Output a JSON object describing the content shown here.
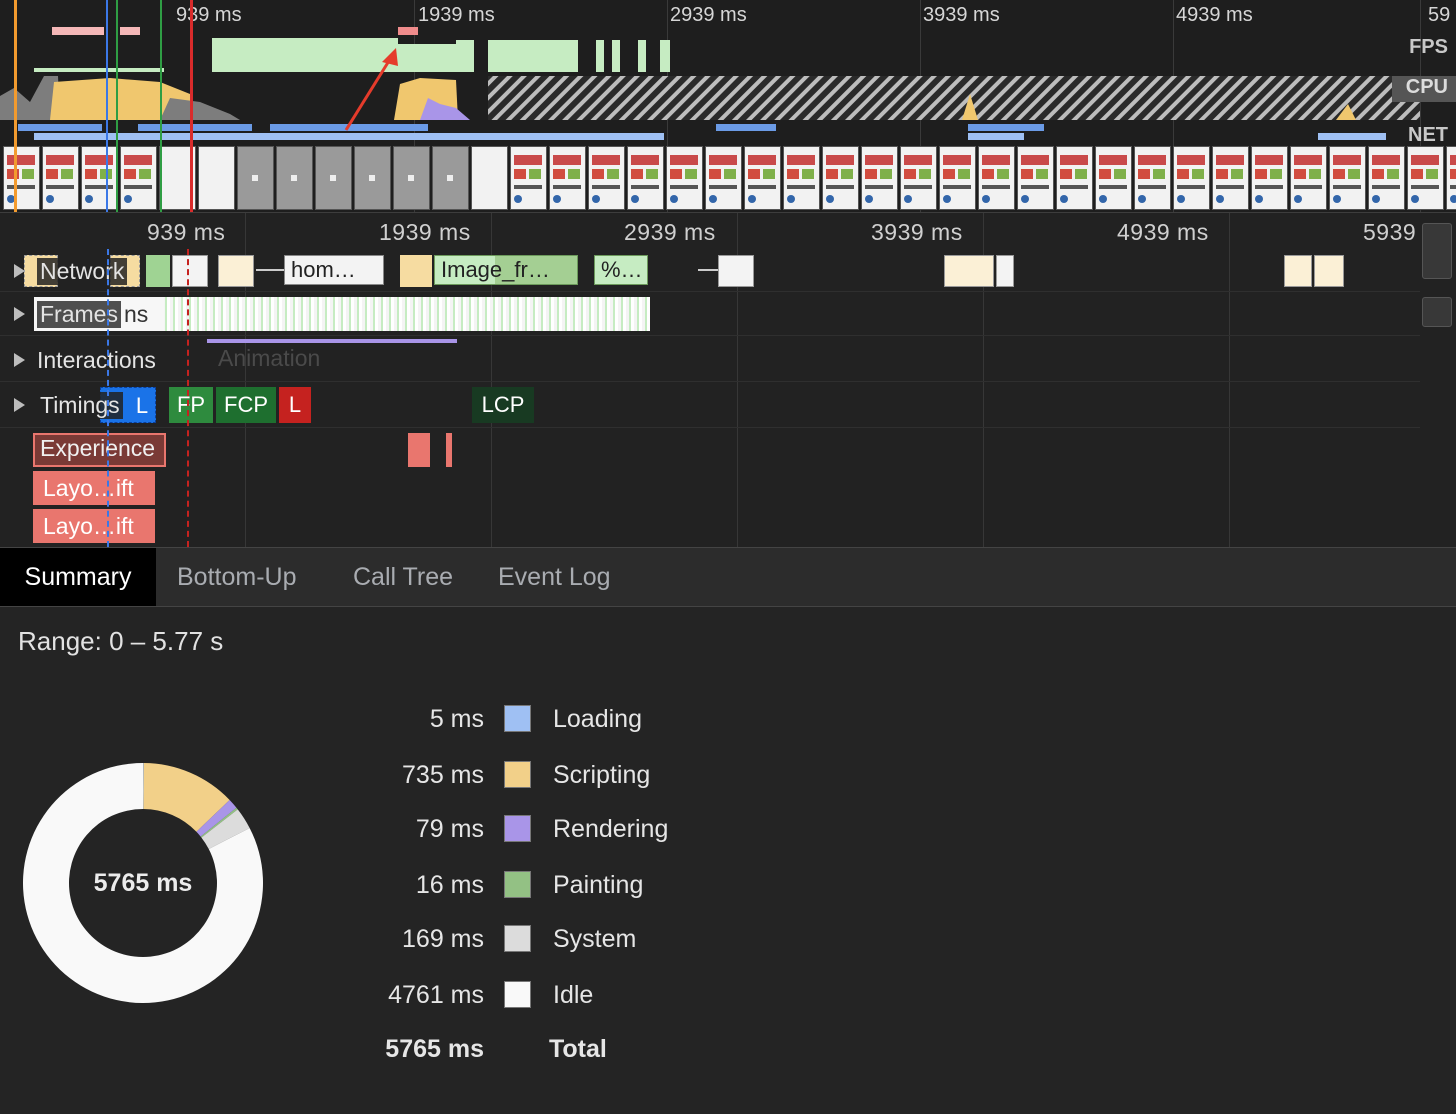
{
  "overview": {
    "ticks": [
      "939 ms",
      "1939 ms",
      "2939 ms",
      "3939 ms",
      "4939 ms",
      "59"
    ],
    "lanes": {
      "fps": "FPS",
      "cpu": "CPU",
      "net": "NET"
    }
  },
  "main": {
    "ticks": [
      "939 ms",
      "1939 ms",
      "2939 ms",
      "3939 ms",
      "4939 ms",
      "5939"
    ],
    "tracks": {
      "network": "Network",
      "frames": "Frames",
      "frames_under": "ns",
      "interactions": "Interactions",
      "animation": "Animation",
      "timings": "Timings",
      "experience": "Experience"
    },
    "network_items": {
      "home": "hom…",
      "image": "Image_fr…",
      "percent": "%…"
    },
    "timings": {
      "dcl": "L",
      "fp": "FP",
      "fcp": "FCP",
      "l": "L",
      "lcp": "LCP"
    },
    "layout_shift_label": "Layo…ift"
  },
  "tabs": [
    "Summary",
    "Bottom-Up",
    "Call Tree",
    "Event Log"
  ],
  "active_tab": "Summary",
  "summary": {
    "range": "Range: 0 – 5.77 s",
    "total_center": "5765 ms",
    "rows": [
      {
        "value": "5 ms",
        "label": "Loading",
        "color": "#9fc0f3"
      },
      {
        "value": "735 ms",
        "label": "Scripting",
        "color": "#f2d089"
      },
      {
        "value": "79 ms",
        "label": "Rendering",
        "color": "#a995e8"
      },
      {
        "value": "16 ms",
        "label": "Painting",
        "color": "#93c184"
      },
      {
        "value": "169 ms",
        "label": "System",
        "color": "#dcdcdc"
      },
      {
        "value": "4761 ms",
        "label": "Idle",
        "color": "#f9f9f9"
      }
    ],
    "total": {
      "value": "5765 ms",
      "label": "Total"
    }
  },
  "chart_data": {
    "type": "pie",
    "categories": [
      "Loading",
      "Scripting",
      "Rendering",
      "Painting",
      "System",
      "Idle"
    ],
    "values": [
      5,
      735,
      79,
      16,
      169,
      4761
    ],
    "colors": [
      "#9fc0f3",
      "#f2d089",
      "#a995e8",
      "#93c184",
      "#dcdcdc",
      "#f9f9f9"
    ],
    "title": "5765 ms"
  }
}
